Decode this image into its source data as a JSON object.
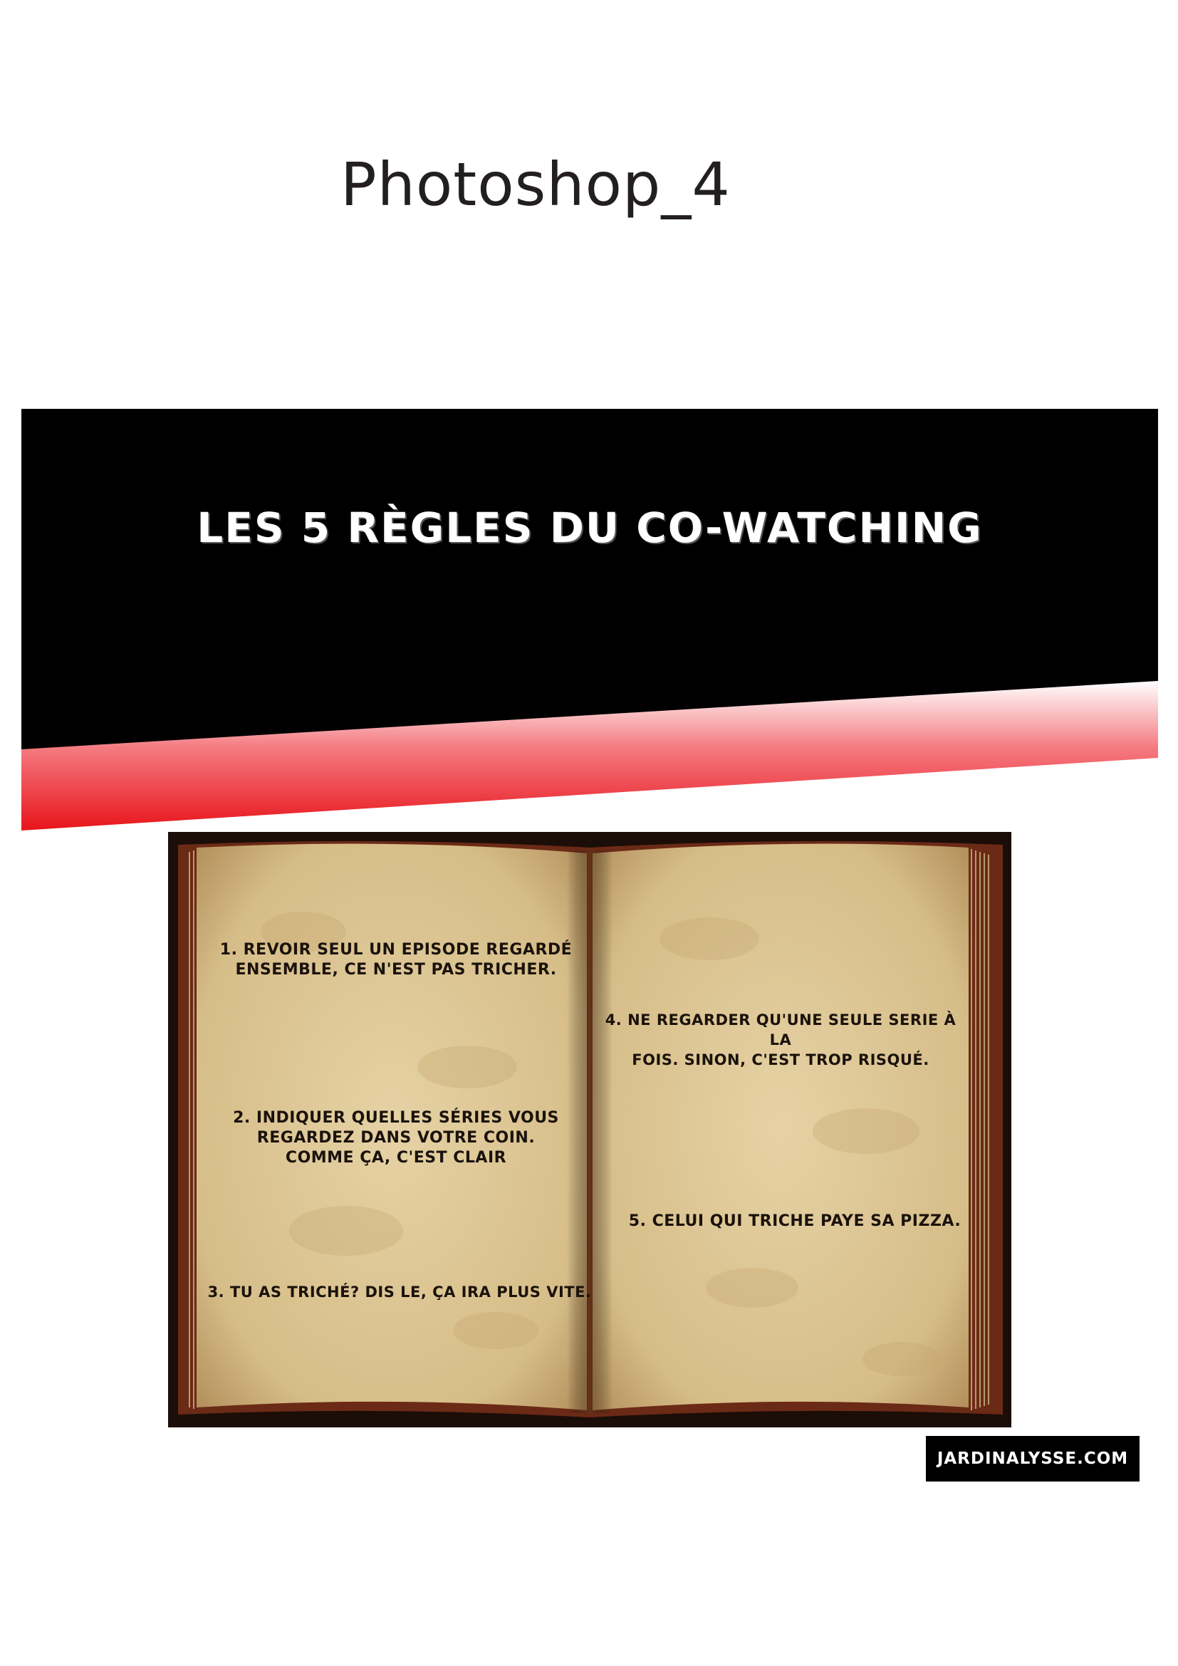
{
  "document": {
    "title": "Photoshop_4"
  },
  "banner": {
    "title": "Les 5 règles du co-watching"
  },
  "book": {
    "rules": [
      {
        "id": "rule-1",
        "lines": [
          "1. Revoir seul un episode regardé",
          "ensemble, ce n'est pas tricher."
        ]
      },
      {
        "id": "rule-2",
        "lines": [
          "2. Indiquer quelles séries vous",
          "regardez dans votre coin.",
          "Comme ça, c'est clair"
        ]
      },
      {
        "id": "rule-3",
        "lines": [
          "3. Tu as triché? Dis le, ça ira plus vite."
        ]
      },
      {
        "id": "rule-4",
        "lines": [
          "4. Ne regarder qu'une seule serie à la",
          "fois. Sinon, c'est trop risqué."
        ]
      },
      {
        "id": "rule-5",
        "lines": [
          "5. Celui qui triche paye sa pizza."
        ]
      }
    ]
  },
  "footer": {
    "badge_text": "Jardinalysse.com"
  },
  "colors": {
    "banner_black": "#000000",
    "accent_red": "#e8141b",
    "page_parchment": "#dcc594",
    "book_cover": "#5a1f12"
  }
}
